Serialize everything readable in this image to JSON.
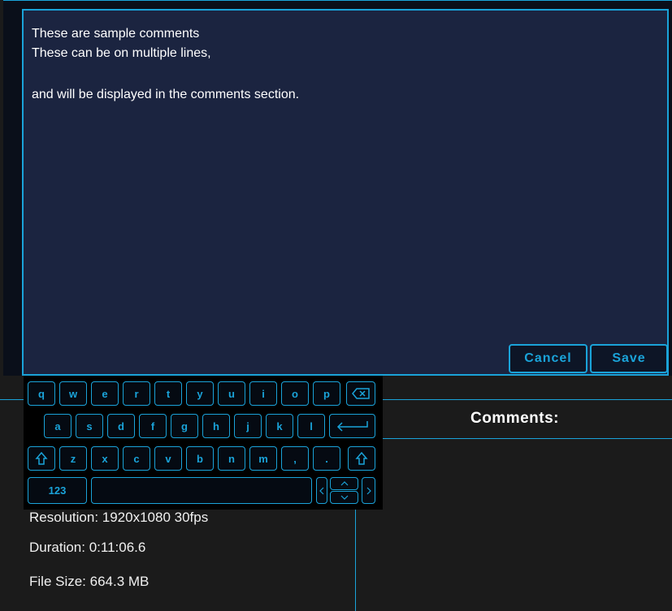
{
  "editor": {
    "comment_lines": [
      "These are sample comments",
      "These can be on multiple lines,",
      "",
      "and will be displayed in the comments section."
    ],
    "cancel_label": "Cancel",
    "save_label": "Save"
  },
  "keyboard": {
    "row1": [
      "q",
      "w",
      "e",
      "r",
      "t",
      "y",
      "u",
      "i",
      "o",
      "p"
    ],
    "row2": [
      "a",
      "s",
      "d",
      "f",
      "g",
      "h",
      "j",
      "k",
      "l"
    ],
    "row3": [
      "z",
      "x",
      "c",
      "v",
      "b",
      "n",
      "m",
      ",",
      "."
    ],
    "numbers_label": "123"
  },
  "details": {
    "resolution": "Resolution:  1920x1080 30fps",
    "duration": "Duration:  0:11:06.6",
    "file_size": "File Size:  664.3 MB"
  },
  "comments_panel": {
    "title": "Comments:"
  },
  "colors": {
    "accent": "#1aa3d9",
    "textarea_bg": "#1b2440",
    "page_bg": "#1b1b1b"
  }
}
